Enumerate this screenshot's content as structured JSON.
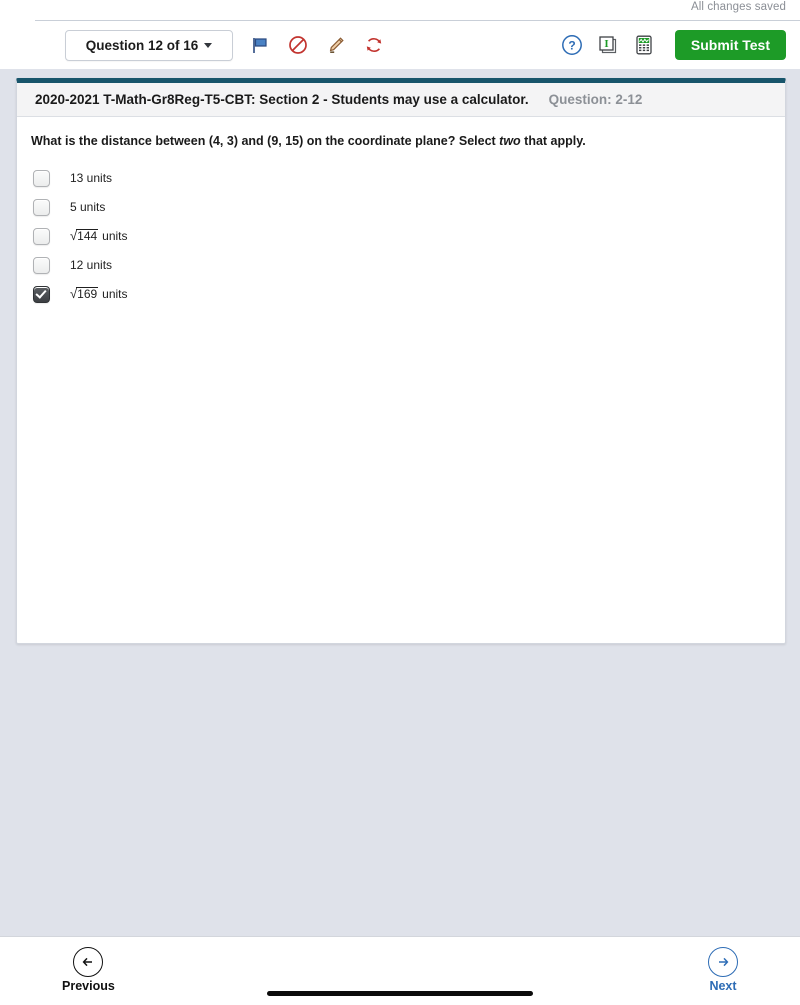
{
  "status": {
    "save_text": "All changes saved"
  },
  "toolbar": {
    "question_nav_label": "Question 12 of 16",
    "caret_icon": "chevron-down-icon",
    "tools": [
      {
        "name": "flag-icon",
        "title": "Flag"
      },
      {
        "name": "eliminate-choice-icon",
        "title": "Eliminate Choice"
      },
      {
        "name": "highlighter-icon",
        "title": "Highlighter"
      },
      {
        "name": "reset-icon",
        "title": "Reset"
      }
    ],
    "utilities": [
      {
        "name": "help-icon",
        "title": "Help"
      },
      {
        "name": "notepad-icon",
        "title": "Notepad"
      },
      {
        "name": "calculator-icon",
        "title": "Calculator"
      }
    ],
    "submit_label": "Submit Test",
    "submit_color": "#1d9b27"
  },
  "card": {
    "accent_color": "#18556b",
    "title": "2020-2021 T-Math-Gr8Reg-T5-CBT: Section 2 - Students may use a calculator.",
    "question_number": "Question: 2-12",
    "stem": {
      "before": "What is the distance between (4, 3) and (9, 15) on the coordinate plane?  Select ",
      "emphasis": "two",
      "after": " that apply."
    },
    "options": [
      {
        "text": "13 units",
        "radical": null,
        "units": null,
        "checked": false
      },
      {
        "text": "5 units",
        "radical": null,
        "units": null,
        "checked": false
      },
      {
        "text": null,
        "radical": "144",
        "units": "units",
        "checked": false
      },
      {
        "text": "12 units",
        "radical": null,
        "units": null,
        "checked": false
      },
      {
        "text": null,
        "radical": "169",
        "units": "units",
        "checked": true
      }
    ]
  },
  "bottom_nav": {
    "previous_label": "Previous",
    "next_label": "Next",
    "next_color": "#2d6cb5"
  }
}
